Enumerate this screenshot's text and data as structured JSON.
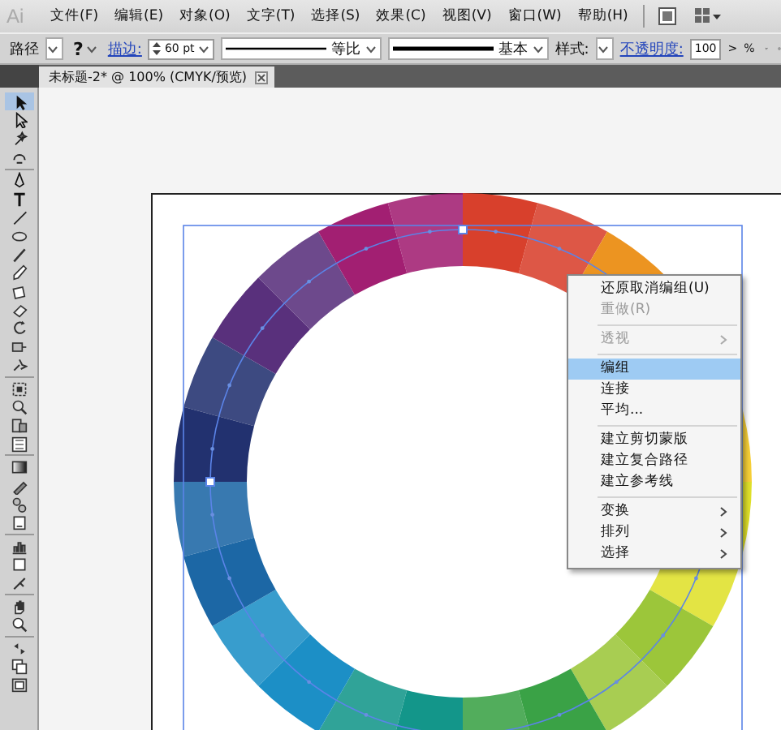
{
  "menubar": {
    "logo": "Ai",
    "items": [
      "文件(F)",
      "编辑(E)",
      "对象(O)",
      "文字(T)",
      "选择(S)",
      "效果(C)",
      "视图(V)",
      "窗口(W)",
      "帮助(H)"
    ]
  },
  "control_bar": {
    "selection_label": "路径",
    "help": "?",
    "stroke_label": "描边:",
    "stroke_weight": "60 pt",
    "profile": "等比",
    "brush": "基本",
    "style_label": "样式:",
    "opacity_label": "不透明度:",
    "opacity": "100",
    "opacity_arrow": ">",
    "percent": "%"
  },
  "document_tab": {
    "title": "未标题-2* @ 100% (CMYK/预览)"
  },
  "tools": [
    {
      "selected": true
    },
    {
      "selected": false
    },
    {
      "selected": false
    },
    {
      "selected": false
    },
    {
      "selected": false
    },
    {
      "selected": false
    },
    {
      "selected": false
    },
    {
      "selected": false
    },
    {
      "selected": false
    },
    {
      "selected": false
    },
    {
      "selected": false
    },
    {
      "selected": false
    },
    {
      "selected": false
    },
    {
      "selected": false
    },
    {
      "selected": false
    },
    {
      "selected": false
    },
    {
      "selected": false
    },
    {
      "selected": false
    },
    {
      "selected": false
    },
    {
      "selected": false
    },
    {
      "selected": false
    },
    {
      "selected": false
    },
    {
      "selected": false
    },
    {
      "selected": false
    },
    {
      "selected": false
    },
    {
      "selected": false
    },
    {
      "selected": false
    },
    {
      "selected": false
    },
    {
      "selected": false
    },
    {
      "selected": false
    },
    {
      "selected": false
    }
  ],
  "context_menu": {
    "items": [
      {
        "kind": "item",
        "label": "还原取消编组(U)",
        "disabled": false,
        "selected": false,
        "submenu": false
      },
      {
        "kind": "item",
        "label": "重做(R)",
        "disabled": true,
        "selected": false,
        "submenu": false
      },
      {
        "kind": "separator"
      },
      {
        "kind": "item",
        "label": "透视",
        "disabled": true,
        "selected": false,
        "submenu": true
      },
      {
        "kind": "separator"
      },
      {
        "kind": "item",
        "label": "编组",
        "disabled": false,
        "selected": true,
        "submenu": false
      },
      {
        "kind": "item",
        "label": "连接",
        "disabled": false,
        "selected": false,
        "submenu": false
      },
      {
        "kind": "item",
        "label": "平均...",
        "disabled": false,
        "selected": false,
        "submenu": false
      },
      {
        "kind": "separator"
      },
      {
        "kind": "item",
        "label": "建立剪切蒙版",
        "disabled": false,
        "selected": false,
        "submenu": false
      },
      {
        "kind": "item",
        "label": "建立复合路径",
        "disabled": false,
        "selected": false,
        "submenu": false
      },
      {
        "kind": "item",
        "label": "建立参考线",
        "disabled": false,
        "selected": false,
        "submenu": false
      },
      {
        "kind": "separator"
      },
      {
        "kind": "item",
        "label": "变换",
        "disabled": false,
        "selected": false,
        "submenu": true
      },
      {
        "kind": "item",
        "label": "排列",
        "disabled": false,
        "selected": false,
        "submenu": true
      },
      {
        "kind": "item",
        "label": "选择",
        "disabled": false,
        "selected": false,
        "submenu": true
      }
    ]
  }
}
